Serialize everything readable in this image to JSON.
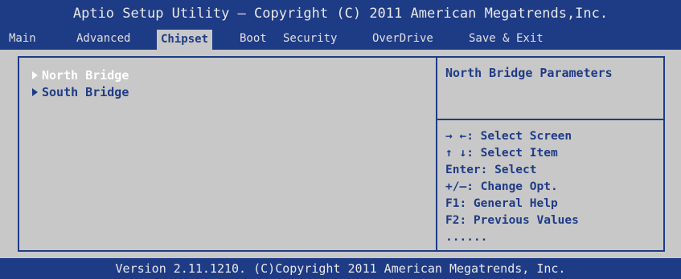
{
  "title_bar": {
    "text": "Aptio Setup Utility – Copyright (C) 2011 American Megatrends,Inc."
  },
  "menu": {
    "tabs": [
      {
        "label": "Main"
      },
      {
        "label": "Advanced"
      },
      {
        "label": "Chipset"
      },
      {
        "label": "Boot"
      },
      {
        "label": "Security"
      },
      {
        "label": "OverDrive"
      },
      {
        "label": "Save & Exit"
      }
    ],
    "active_tab": "Chipset"
  },
  "main": {
    "items": [
      {
        "label": "North Bridge"
      },
      {
        "label": "South Bridge"
      }
    ],
    "selected_item": "North Bridge"
  },
  "help": {
    "title": "North Bridge Parameters",
    "keys": [
      "→ ←: Select Screen",
      "↑ ↓: Select Item",
      "Enter: Select",
      "+/–:  Change Opt.",
      "F1: General Help",
      "F2: Previous Values",
      "......"
    ]
  },
  "footer": {
    "text": "Version 2.11.1210. (C)Copyright 2011 American Megatrends, Inc."
  },
  "colors": {
    "accent": "#1e3b86",
    "panel_bg": "#c8c8c8",
    "highlight": "#ffffff"
  }
}
